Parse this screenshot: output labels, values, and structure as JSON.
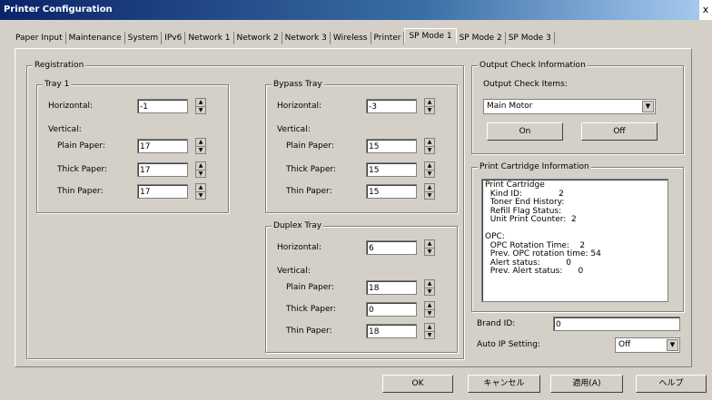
{
  "window": {
    "title": "Printer Configuration",
    "close_glyph": "x"
  },
  "tabs": [
    {
      "label": "Paper Input"
    },
    {
      "label": "Maintenance"
    },
    {
      "label": "System"
    },
    {
      "label": "IPv6"
    },
    {
      "label": "Network 1"
    },
    {
      "label": "Network 2"
    },
    {
      "label": "Network 3"
    },
    {
      "label": "Wireless"
    },
    {
      "label": "Printer"
    },
    {
      "label": "SP Mode 1",
      "active": true
    },
    {
      "label": "SP Mode 2"
    },
    {
      "label": "SP Mode 3"
    }
  ],
  "registration": {
    "title": "Registration",
    "tray1": {
      "title": "Tray 1",
      "horizontal_label": "Horizontal:",
      "horizontal_value": "-1",
      "vertical_label": "Vertical:",
      "plain_label": "Plain Paper:",
      "plain_value": "17",
      "thick_label": "Thick Paper:",
      "thick_value": "17",
      "thin_label": "Thin Paper:",
      "thin_value": "17"
    },
    "bypass": {
      "title": "Bypass Tray",
      "horizontal_label": "Horizontal:",
      "horizontal_value": "-3",
      "vertical_label": "Vertical:",
      "plain_label": "Plain Paper:",
      "plain_value": "15",
      "thick_label": "Thick Paper:",
      "thick_value": "15",
      "thin_label": "Thin Paper:",
      "thin_value": "15"
    },
    "duplex": {
      "title": "Duplex Tray",
      "horizontal_label": "Horizontal:",
      "horizontal_value": "6",
      "vertical_label": "Vertical:",
      "plain_label": "Plain Paper:",
      "plain_value": "18",
      "thick_label": "Thick Paper:",
      "thick_value": "0",
      "thin_label": "Thin Paper:",
      "thin_value": "18"
    }
  },
  "output_check": {
    "title": "Output Check Information",
    "items_label": "Output Check Items:",
    "selected": "Main Motor",
    "on_label": "On",
    "off_label": "Off"
  },
  "cartridge": {
    "title": "Print Cartridge Information",
    "text": "Print Cartridge\n  Kind ID:              2\n  Toner End History:\n  Refill Flag Status:\n  Unit Print Counter:  2\n\nOPC:\n  OPC Rotation Time:    2\n  Prev. OPC rotation time: 54\n  Alert status:          0\n  Prev. Alert status:      0"
  },
  "brand": {
    "label": "Brand ID:",
    "value": "0"
  },
  "auto_ip": {
    "label": "Auto IP Setting:",
    "value": "Off"
  },
  "footer": {
    "ok": "OK",
    "cancel": "キャンセル",
    "apply": "適用(A)",
    "help": "ヘルプ"
  }
}
